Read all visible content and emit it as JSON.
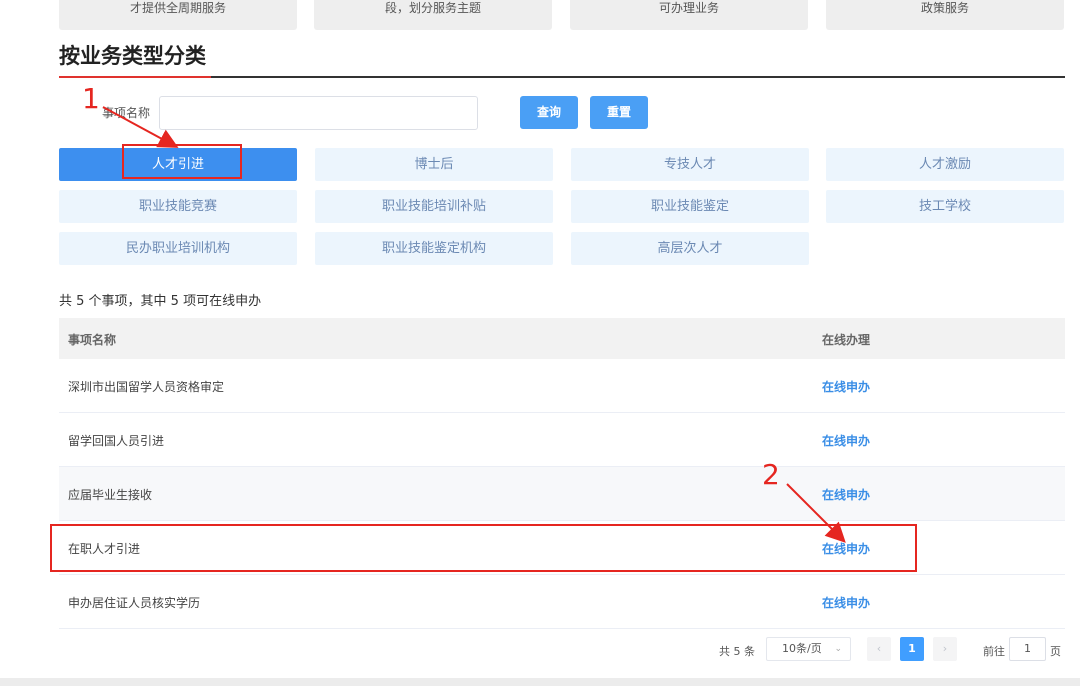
{
  "top_cards": [
    "才提供全周期服务",
    "段，划分服务主题",
    "可办理业务",
    "政策服务"
  ],
  "section_title": "按业务类型分类",
  "search": {
    "label": "事项名称",
    "value": "",
    "placeholder": ""
  },
  "buttons": {
    "query": "查询",
    "reset": "重置"
  },
  "categories": [
    {
      "label": "人才引进",
      "active": true
    },
    {
      "label": "博士后",
      "active": false
    },
    {
      "label": "专技人才",
      "active": false
    },
    {
      "label": "人才激励",
      "active": false
    },
    {
      "label": "职业技能竞赛",
      "active": false
    },
    {
      "label": "职业技能培训补贴",
      "active": false
    },
    {
      "label": "职业技能鉴定",
      "active": false
    },
    {
      "label": "技工学校",
      "active": false
    },
    {
      "label": "民办职业培训机构",
      "active": false
    },
    {
      "label": "职业技能鉴定机构",
      "active": false
    },
    {
      "label": "高层次人才",
      "active": false
    }
  ],
  "summary": "共 5 个事项，其中 5 项可在线申办",
  "table": {
    "columns": [
      "事项名称",
      "在线办理"
    ],
    "rows": [
      {
        "name": "深圳市出国留学人员资格审定",
        "action": "在线申办"
      },
      {
        "name": "留学回国人员引进",
        "action": "在线申办"
      },
      {
        "name": "应届毕业生接收",
        "action": "在线申办"
      },
      {
        "name": "在职人才引进",
        "action": "在线申办"
      },
      {
        "name": "申办居住证人员核实学历",
        "action": "在线申办"
      }
    ]
  },
  "pagination": {
    "total": "共 5 条",
    "page_size": "10条/页",
    "prev_icon": "chevron-left-icon",
    "next_icon": "chevron-right-icon",
    "current_page": "1",
    "goto_label": "前往",
    "goto_value": "1",
    "page_suffix": "页"
  },
  "annotations": {
    "step1": "1",
    "step2": "2"
  },
  "colors": {
    "primary": "#409eff",
    "category_bg": "#ecf5fd",
    "annotation": "#e52620",
    "link": "#3a8ee6"
  }
}
